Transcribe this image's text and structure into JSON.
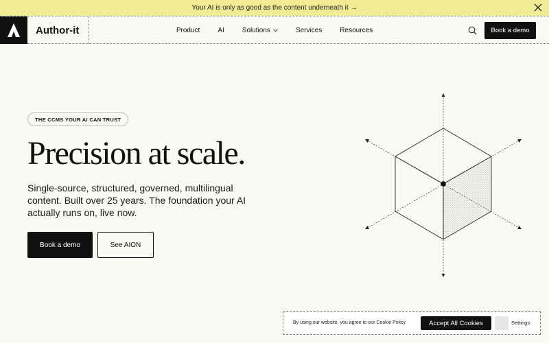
{
  "banner": {
    "text": "Your AI is only as good as the content underneath it →"
  },
  "brand": {
    "name": "Author-it"
  },
  "nav": {
    "items": [
      {
        "label": "Product"
      },
      {
        "label": "AI"
      },
      {
        "label": "Solutions",
        "has_dropdown": true
      },
      {
        "label": "Services"
      },
      {
        "label": "Resources"
      }
    ],
    "cta_label": "Book a demo"
  },
  "hero": {
    "tag": "THE CCMS YOUR AI CAN TRUST",
    "title": "Precision at scale.",
    "subtitle": "Single-source, structured, governed, multilingual content. Built over 25 years. The foundation your AI actually runs on, live now.",
    "primary_cta": "Book a demo",
    "secondary_cta": "See AION"
  },
  "cookie": {
    "text": "By using our website, you agree to our Cookie Policy",
    "accept_label": "Accept All Cookies",
    "settings_label": "Settings"
  },
  "colors": {
    "banner_bg": "#f2eb96",
    "page_bg": "#fbf9f3",
    "primary": "#111111"
  },
  "icons": {
    "banner_close": "close-icon",
    "logo": "logo-mark-icon",
    "search": "search-icon",
    "dropdown": "chevron-down-icon"
  }
}
